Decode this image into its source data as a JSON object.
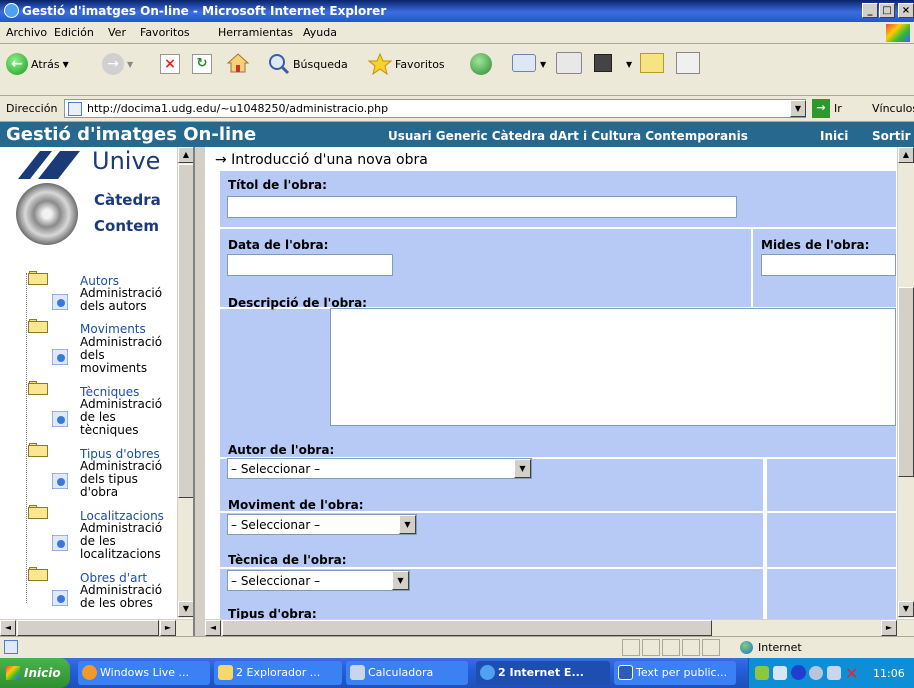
{
  "window": {
    "title": "Gestió d'imatges On-line - Microsoft Internet Explorer",
    "minimize": "_",
    "maximize": "□",
    "close": "×"
  },
  "menu": [
    "Archivo",
    "Edición",
    "Ver",
    "Favoritos",
    "Herramientas",
    "Ayuda"
  ],
  "toolbar": {
    "back_label": "Atrás",
    "search_label": "Búsqueda",
    "favorites_label": "Favoritos"
  },
  "address": {
    "label": "Dirección",
    "url": "http://docima1.udg.edu/~u1048250/administracio.php",
    "go_label": "Ir",
    "links_label": "Vínculos"
  },
  "app": {
    "title": "Gestió d'imatges On-line",
    "user": "Usuari Generic Càtedra dArt i Cultura Contemporanis",
    "home": "Inici",
    "exit": "Sortir"
  },
  "logo": {
    "univ": "Unive",
    "line1": "Càtedra",
    "line2": "Contem"
  },
  "tree": [
    {
      "category": "Autors",
      "sub": [
        "Administració",
        "dels autors"
      ]
    },
    {
      "category": "Moviments",
      "sub": [
        "Administració",
        "dels",
        "moviments"
      ]
    },
    {
      "category": "Tècniques",
      "sub": [
        "Administració",
        "de les",
        "tècniques"
      ]
    },
    {
      "category": "Tipus d'obres",
      "sub": [
        "Administració",
        "dels tipus",
        "d'obra"
      ]
    },
    {
      "category": "Localitzacions",
      "sub": [
        "Administració",
        "de les",
        "localitzacions"
      ]
    },
    {
      "category": "Obres d'art",
      "sub": [
        "Administració",
        "de les obres"
      ]
    }
  ],
  "form": {
    "heading": "→ Introducció d'una nova obra",
    "title_label": "Títol de l'obra:",
    "date_label": "Data de l'obra:",
    "size_label": "Mides de l'obra:",
    "description_label": "Descripció de l'obra:",
    "author_label": "Autor de l'obra:",
    "author_value": "– Seleccionar –",
    "movement_label": "Moviment de l'obra:",
    "movement_value": "– Seleccionar –",
    "technique_label": "Tècnica de l'obra:",
    "technique_value": "– Seleccionar –",
    "type_label": "Tipus d'obra:"
  },
  "status": {
    "zone": "Internet"
  },
  "taskbar": {
    "start": "Inicio",
    "tasks": [
      "Windows Live ...",
      "2 Explorador ...",
      "Calculadora",
      "2 Internet E...",
      "Text per public..."
    ],
    "clock": "11:06"
  },
  "colors": {
    "app_header": "#27688f",
    "form_bg": "#b7c9f5",
    "tree_category": "#1a4fa0"
  }
}
